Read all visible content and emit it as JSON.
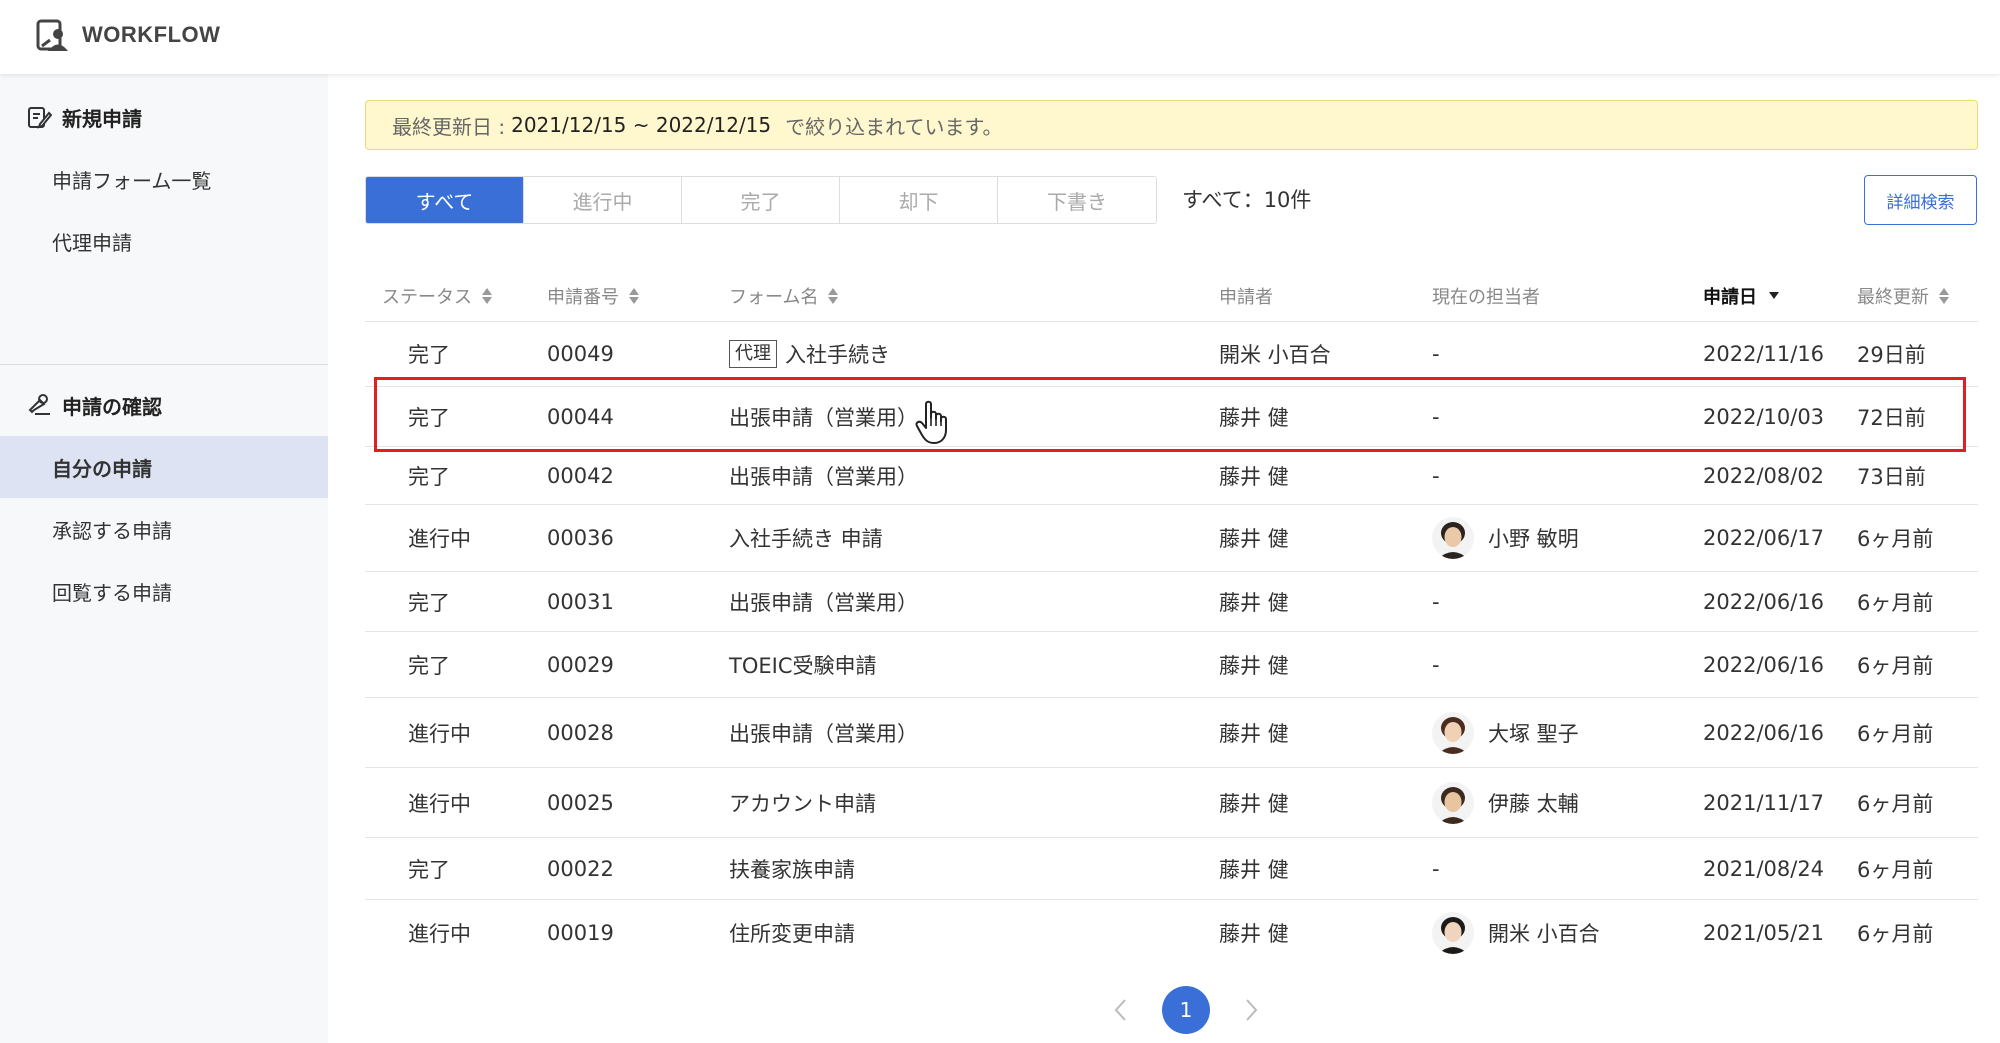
{
  "app": {
    "title": "WORKFLOW"
  },
  "sidebar": {
    "sections": [
      {
        "label": "新規申請",
        "items": [
          "申請フォーム一覧",
          "代理申請"
        ]
      },
      {
        "label": "申請の確認",
        "items": [
          "自分の申請",
          "承認する申請",
          "回覧する申請"
        ]
      }
    ],
    "active_item": "自分の申請"
  },
  "banner": {
    "prefix": "最終更新日 :",
    "range": "2021/12/15 ~ 2022/12/15",
    "suffix": "で絞り込まれています。"
  },
  "tabs": [
    "すべて",
    "進行中",
    "完了",
    "却下",
    "下書き"
  ],
  "active_tab": "すべて",
  "count_text": "すべて：10件",
  "advanced_search_label": "詳細検索",
  "table": {
    "headers": [
      "ステータス",
      "申請番号",
      "フォーム名",
      "申請者",
      "現在の担当者",
      "申請日",
      "最終更新"
    ],
    "sorted_column": "申請日",
    "rows": [
      {
        "status": "完了",
        "number": "00049",
        "tag": "代理",
        "form": "入社手続き",
        "applicant": "開米 小百合",
        "assignee": "-",
        "date": "2022/11/16",
        "updated": "29日前"
      },
      {
        "status": "完了",
        "number": "00044",
        "tag": "",
        "form": "出張申請（営業用）",
        "applicant": "藤井 健",
        "assignee": "-",
        "date": "2022/10/03",
        "updated": "72日前"
      },
      {
        "status": "完了",
        "number": "00042",
        "tag": "",
        "form": "出張申請（営業用）",
        "applicant": "藤井 健",
        "assignee": "-",
        "date": "2022/08/02",
        "updated": "73日前"
      },
      {
        "status": "進行中",
        "number": "00036",
        "tag": "",
        "form": "入社手続き 申請",
        "applicant": "藤井 健",
        "assignee": "小野 敏明",
        "date": "2022/06/17",
        "updated": "6ヶ月前"
      },
      {
        "status": "完了",
        "number": "00031",
        "tag": "",
        "form": "出張申請（営業用）",
        "applicant": "藤井 健",
        "assignee": "-",
        "date": "2022/06/16",
        "updated": "6ヶ月前"
      },
      {
        "status": "完了",
        "number": "00029",
        "tag": "",
        "form": "TOEIC受験申請",
        "applicant": "藤井 健",
        "assignee": "-",
        "date": "2022/06/16",
        "updated": "6ヶ月前"
      },
      {
        "status": "進行中",
        "number": "00028",
        "tag": "",
        "form": "出張申請（営業用）",
        "applicant": "藤井 健",
        "assignee": "大塚 聖子",
        "date": "2022/06/16",
        "updated": "6ヶ月前"
      },
      {
        "status": "進行中",
        "number": "00025",
        "tag": "",
        "form": "アカウント申請",
        "applicant": "藤井 健",
        "assignee": "伊藤 太輔",
        "date": "2021/11/17",
        "updated": "6ヶ月前"
      },
      {
        "status": "完了",
        "number": "00022",
        "tag": "",
        "form": "扶養家族申請",
        "applicant": "藤井 健",
        "assignee": "-",
        "date": "2021/08/24",
        "updated": "6ヶ月前"
      },
      {
        "status": "進行中",
        "number": "00019",
        "tag": "",
        "form": "住所変更申請",
        "applicant": "藤井 健",
        "assignee": "開米 小百合",
        "date": "2021/05/21",
        "updated": "6ヶ月前"
      }
    ]
  },
  "pagination": {
    "current_page": "1"
  },
  "colors": {
    "accent": "#3a6fd8",
    "highlight": "#e02020",
    "banner_bg": "#fff8cf"
  },
  "icons": {
    "logo": "workflow-logo-icon",
    "new_request": "edit-document-icon",
    "confirm": "stamp-icon"
  }
}
